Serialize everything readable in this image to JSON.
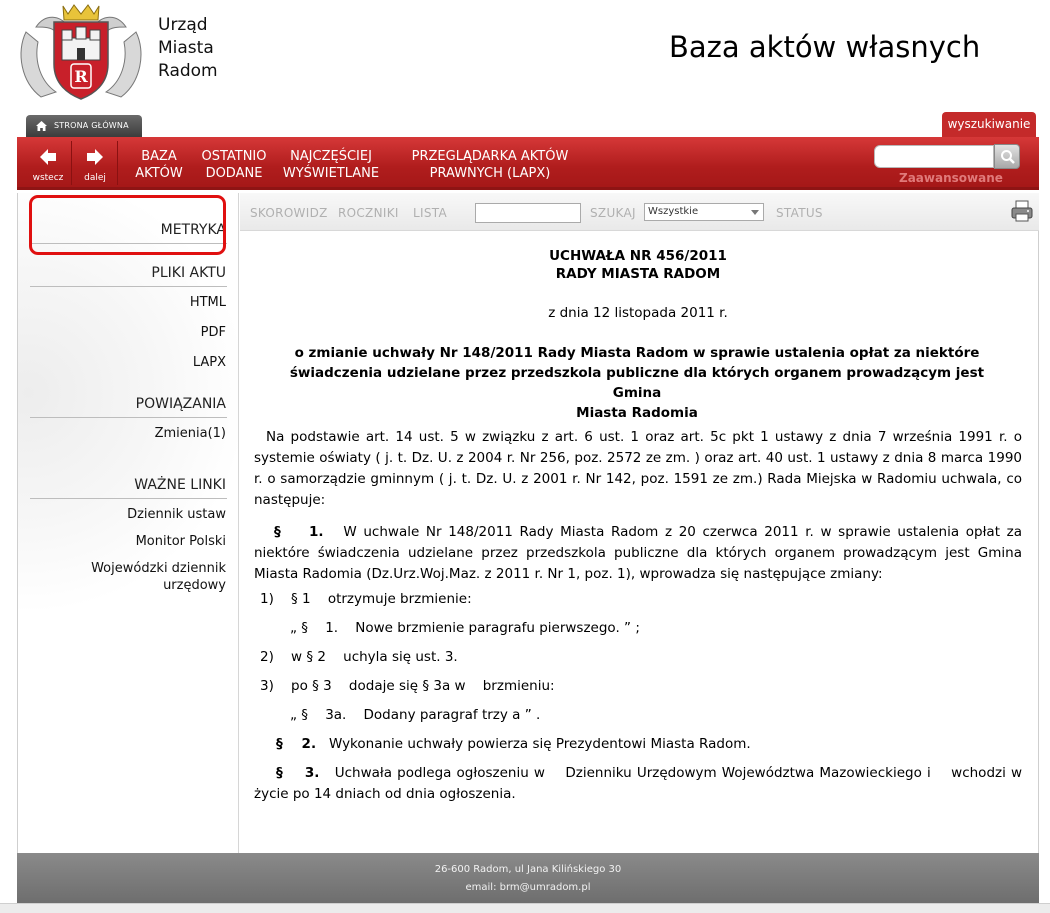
{
  "header": {
    "city_name_line1": "Urząd",
    "city_name_line2": "Miasta",
    "city_name_line3": "Radom",
    "site_title": "Baza aktów własnych",
    "crest_letter": "R"
  },
  "tabs": {
    "home_label": "STRONA GŁÓWNA",
    "search_label": "wyszukiwanie"
  },
  "nav": {
    "back_label": "wstecz",
    "forward_label": "dalej",
    "links": [
      {
        "line1": "BAZA",
        "line2": "AKTÓW"
      },
      {
        "line1": "OSTATNIO",
        "line2": "DODANE"
      },
      {
        "line1": "NAJCZĘŚCIEJ",
        "line2": "WYŚWIETLANE"
      },
      {
        "line1": "PRZEGLĄDARKA AKTÓW",
        "line2": "PRAWNYCH (LAPX)"
      }
    ],
    "search_value": "",
    "advanced_label": "Zaawansowane"
  },
  "sidebar": {
    "metryka": "METRYKA",
    "pliki_heading": "PLIKI AKTU",
    "files": [
      "HTML",
      "PDF",
      "LAPX"
    ],
    "powiazania_heading": "POWIĄZANIA",
    "zmienia": "Zmienia(1)",
    "links_heading": "WAŻNE LINKI",
    "links": [
      "Dziennik ustaw",
      "Monitor Polski",
      "Wojewódzki dziennik",
      "urzędowy"
    ]
  },
  "toolbar": {
    "skorowidz": "SKOROWIDZ",
    "roczniki": "ROCZNIKI",
    "lista": "LISTA",
    "search_value": "",
    "szukaj": "SZUKAJ",
    "select_value": "Wszystkie",
    "status": "STATUS"
  },
  "document": {
    "title1": "UCHWAŁA NR 456/2011",
    "title2": "RADY MIASTA RADOM",
    "date": "z dnia 12 listopada 2011 r.",
    "subject_line1": "o zmianie uchwały Nr 148/2011 Rady Miasta Radom w    sprawie ustalenia opłat za niektóre",
    "subject_line2": "świadczenia udzielane przez przedszkola publiczne dla których organem prowadzącym jest Gmina",
    "subject_line3": "Miasta Radomia",
    "preamble": "Na podstawie art. 14 ust. 5    w związku z    art. 6    ust. 1    oraz art. 5c pkt 1    ustawy z    dnia 7    września 1991 r. o    systemie oświaty ( j. t. Dz. U. z    2004 r. Nr 256, poz. 2572 ze zm. ) oraz art. 40 ust. 1    ustawy z    dnia 8 marca 1990 r. o    samorządzie gminnym ( j. t. Dz. U. z    2001 r. Nr 142, poz. 1591 ze zm.) Rada Miejska w Radomiu uchwala, co    następuje:",
    "p1_mark": "§    1.",
    "p1_text": "W uchwale Nr 148/2011 Rady Miasta Radom z    20 czerwca 2011 r. w    sprawie ustalenia opłat za niektóre świadczenia udzielane przez przedszkola publiczne dla których organem prowadzącym jest Gmina Miasta Radomia (Dz.Urz.Woj.Maz. z    2011 r. Nr 1, poz. 1), wprowadza się następujące zmiany:",
    "item1": "1)    § 1    otrzymuje brzmienie:",
    "item1_quote": "„ §    1.    Nowe brzmienie paragrafu pierwszego. ” ;",
    "item2": "2)    w § 2    uchyla się ust. 3.",
    "item3": "3)    po § 3    dodaje się § 3a w    brzmieniu:",
    "item3_quote": "„ §    3a.    Dodany paragraf trzy a ” .",
    "p2_mark": "§    2.",
    "p2_text": "Wykonanie uchwały powierza się Prezydentowi Miasta Radom.",
    "p3_mark": "§    3.",
    "p3_text": "Uchwała podlega ogłoszeniu w    Dzienniku Urzędowym Województwa Mazowieckiego i    wchodzi w    życie po 14 dniach od dnia ogłoszenia."
  },
  "footer": {
    "address": "26-600 Radom, ul Jana Kilińskiego 30",
    "email": "email: brm@umradom.pl"
  },
  "colors": {
    "nav_red": "#b01d1d",
    "highlight": "#e01010",
    "footer_gray": "#7a7a7a"
  }
}
